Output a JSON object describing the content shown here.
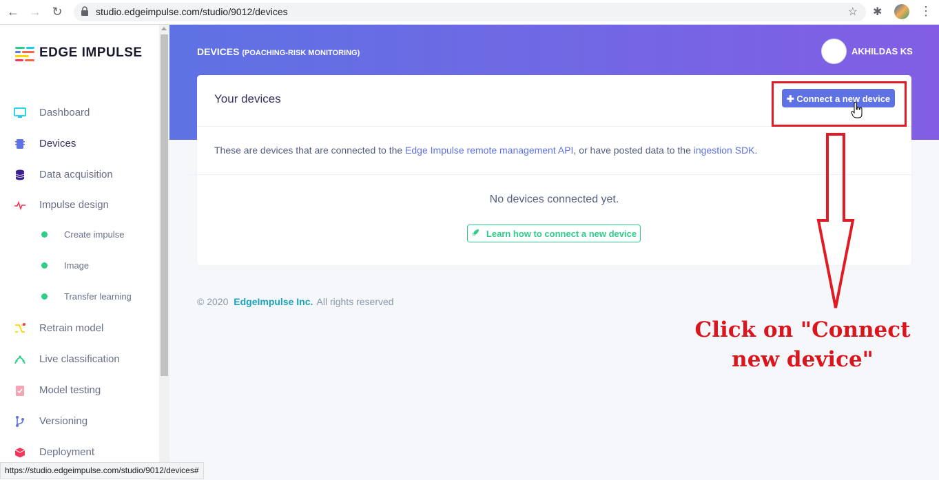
{
  "browser": {
    "url": "studio.edgeimpulse.com/studio/9012/devices",
    "status_url": "https://studio.edgeimpulse.com/studio/9012/devices#"
  },
  "brand": {
    "name": "EDGE IMPULSE"
  },
  "sidebar": {
    "items": [
      {
        "label": "Dashboard",
        "icon": "monitor-icon"
      },
      {
        "label": "Devices",
        "icon": "chip-icon"
      },
      {
        "label": "Data acquisition",
        "icon": "database-icon"
      },
      {
        "label": "Impulse design",
        "icon": "pulse-icon"
      },
      {
        "label": "Create impulse",
        "icon": "dot-icon"
      },
      {
        "label": "Image",
        "icon": "dot-icon"
      },
      {
        "label": "Transfer learning",
        "icon": "dot-icon"
      },
      {
        "label": "Retrain model",
        "icon": "shuffle-icon"
      },
      {
        "label": "Live classification",
        "icon": "graph-icon"
      },
      {
        "label": "Model testing",
        "icon": "clipboard-check-icon"
      },
      {
        "label": "Versioning",
        "icon": "branch-icon"
      },
      {
        "label": "Deployment",
        "icon": "box-icon"
      }
    ]
  },
  "header": {
    "title": "DEVICES",
    "project": "(POACHING-RISK MONITORING)",
    "user": "AKHILDAS KS"
  },
  "card": {
    "title": "Your devices",
    "connect_label": "Connect a new device",
    "text_pre": "These are devices that are connected to the ",
    "link1": "Edge Impulse remote management API",
    "text_mid": ", or have posted data to the ",
    "link2": "ingestion SDK",
    "text_post": ".",
    "empty": "No devices connected yet.",
    "learn_label": "Learn how to connect a new device"
  },
  "footer": {
    "copyright": "© 2020",
    "company": "EdgeImpulse Inc.",
    "rights": "All rights reserved"
  },
  "annotation": {
    "line1": "Click on \"Connect",
    "line2": "new device\"",
    "color": "#d9161e"
  },
  "colors": {
    "accent": "#5e72e4",
    "success": "#2dce89",
    "footer_link": "#1aa3b8"
  }
}
